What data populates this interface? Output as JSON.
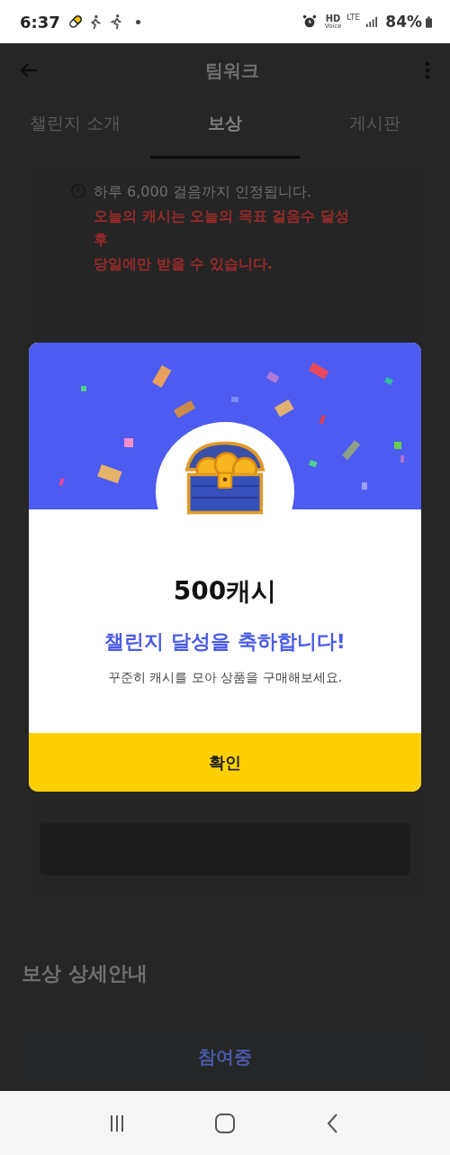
{
  "status_bar": {
    "time": "6:37",
    "hd": "HD",
    "voice": "Voice",
    "lte": "LTE",
    "battery": "84%"
  },
  "header": {
    "title": "팀워크"
  },
  "tabs": [
    {
      "label": "챌린지 소개",
      "selected": false
    },
    {
      "label": "보상",
      "selected": true
    },
    {
      "label": "게시판",
      "selected": false
    }
  ],
  "notice": {
    "text": "하루 6,000 걸음까지 인정됩니다.",
    "warning_lines": [
      "오늘의 캐시는 오늘의 목표 걸음수 달성",
      "후",
      "당일에만 받을 수 있습니다."
    ]
  },
  "section": {
    "title": "보상 상세안내"
  },
  "participate_button": {
    "label": "참여중"
  },
  "dialog": {
    "amount": "500캐시",
    "title": "챌린지 달성을 축하합니다!",
    "message": "꾸준히 캐시를 모아 상품을 구매해보세요.",
    "confirm": "확인"
  }
}
